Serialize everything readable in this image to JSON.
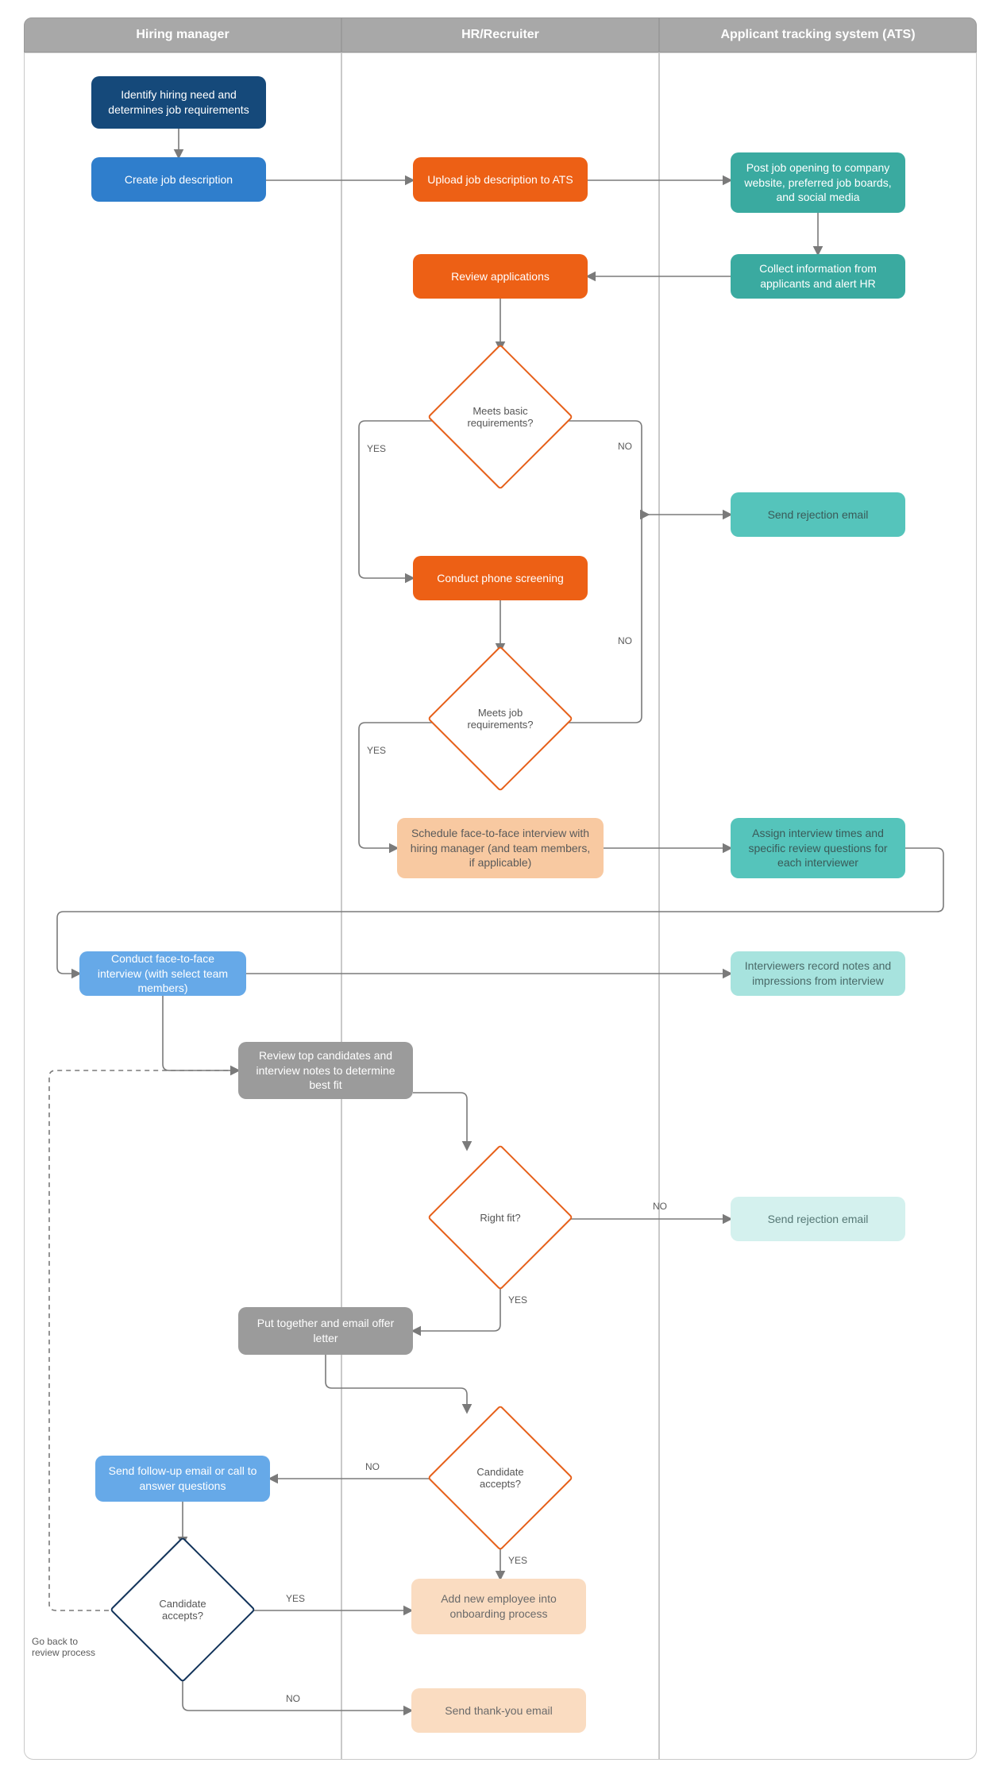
{
  "lanes": {
    "lane1": "Hiring manager",
    "lane2": "HR/Recruiter",
    "lane3": "Applicant tracking system (ATS)"
  },
  "nodes": {
    "identify": "Identify hiring need and determines job requirements",
    "createJD": "Create job description",
    "uploadJD": "Upload job description to ATS",
    "postJob": "Post job opening to company website, preferred job boards, and social media",
    "collectInfo": "Collect information from applicants and alert HR",
    "reviewApps": "Review applications",
    "basicReq": "Meets basic requirements?",
    "phoneScreen": "Conduct phone screening",
    "sendReject1": "Send rejection email",
    "jobReq": "Meets job requirements?",
    "schedule": "Schedule face-to-face interview with hiring manager (and team members, if applicable)",
    "assignTimes": "Assign interview times and specific review questions for each interviewer",
    "conductF2F": "Conduct face-to-face interview (with select team members)",
    "recordNotes": "Interviewers record notes and impressions from interview",
    "reviewTop": "Review top candidates and interview notes to determine best fit",
    "rightFit": "Right fit?",
    "sendReject2": "Send rejection email",
    "offerLetter": "Put together and email offer letter",
    "candAccepts1": "Candidate accepts?",
    "followUp": "Send follow-up email or call to answer questions",
    "candAccepts2": "Candidate accepts?",
    "onboard": "Add new employee into onboarding process",
    "thankyou": "Send thank-you email",
    "goBack": "Go back to review process"
  },
  "labels": {
    "yes": "YES",
    "no": "NO"
  },
  "colors": {
    "blue_dark": "#15497a",
    "blue": "#2f7ecc",
    "blue_light": "#66a9e8",
    "orange": "#ed6015",
    "orange_border": "#e6601a",
    "orange_light": "#f8c9a1",
    "orange_vlight": "#fadcc1",
    "teal": "#3aaaa0",
    "teal_mid": "#55c4bb",
    "teal_light": "#a7e3de",
    "teal_vlight": "#d4f1ee",
    "gray": "#9b9b9b",
    "navy": "#12335a",
    "arrow": "#7a7a7a"
  }
}
